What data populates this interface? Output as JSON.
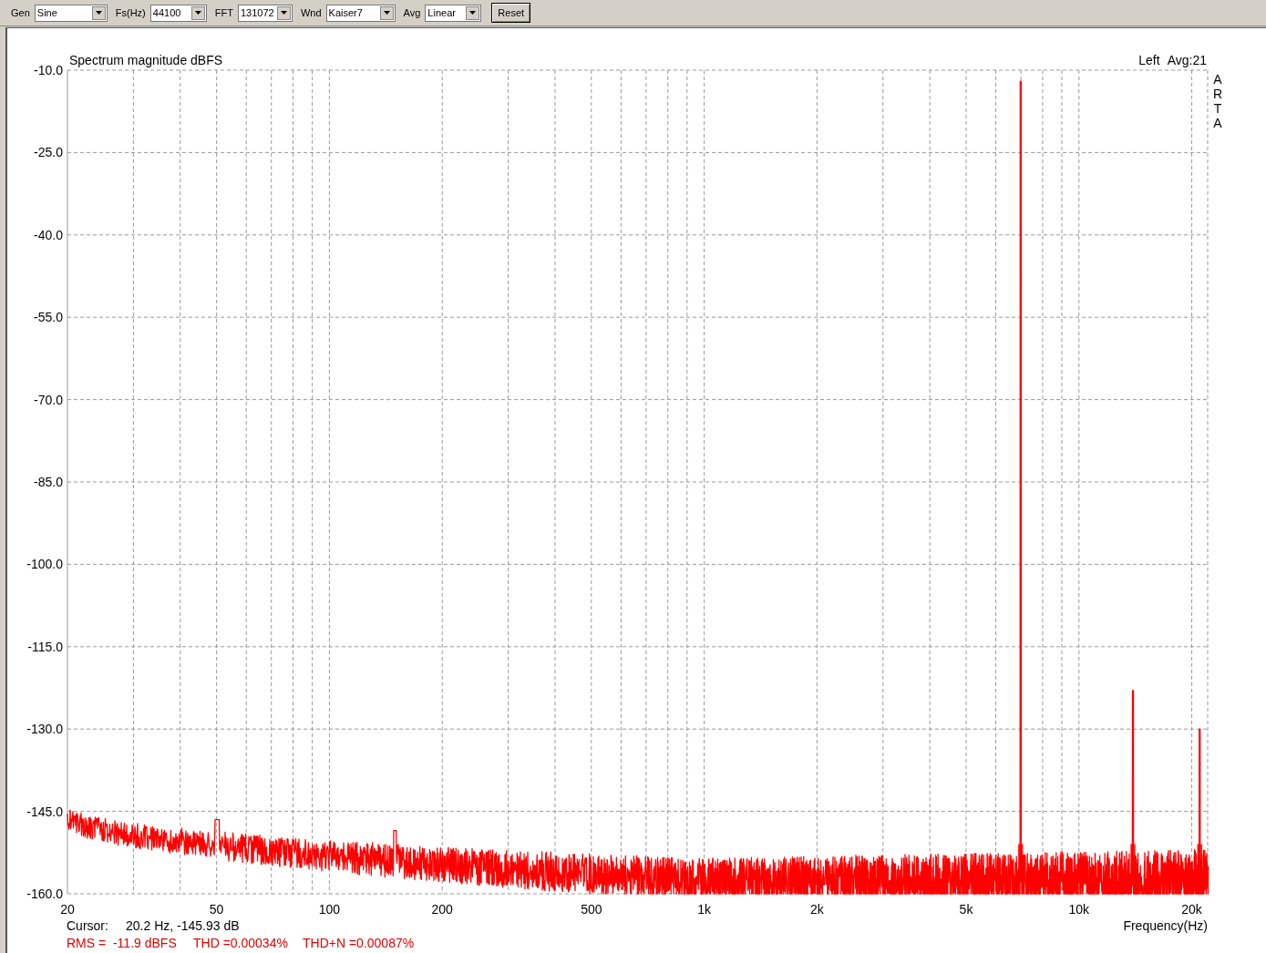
{
  "toolbar": [
    {
      "kind": "select",
      "label": "Gen",
      "value": "Sine"
    },
    {
      "kind": "select",
      "label": "Fs(Hz)",
      "value": "44100"
    },
    {
      "kind": "select",
      "label": "FFT",
      "value": "131072"
    },
    {
      "kind": "select",
      "label": "Wnd",
      "value": "Kaiser7"
    },
    {
      "kind": "select",
      "label": "Avg",
      "value": "Linear"
    },
    {
      "kind": "button",
      "label": "Reset"
    }
  ],
  "graph": {
    "title": "Spectrum magnitude dBFS",
    "channel": "Left",
    "avg_info": "Avg:21",
    "logo": "ARTA",
    "y_axis_labels": [
      "-10.0",
      "-25.0",
      "-40.0",
      "-55.0",
      "-70.0",
      "-85.0",
      "-100.0",
      "-115.0",
      "-130.0",
      "-145.0",
      "-160.0"
    ],
    "x_axis_labels": [
      "20",
      "50",
      "100",
      "200",
      "500",
      "1k",
      "2k",
      "5k",
      "10k",
      "20k"
    ],
    "x_axis_title": "Frequency(Hz)",
    "cursor_label": "Cursor:",
    "cursor_value": "20.2 Hz, -145.93 dB",
    "stats": [
      "RMS =  -11.9 dBFS",
      "THD =0.00034%",
      "THD+N =0.00087%"
    ]
  }
}
